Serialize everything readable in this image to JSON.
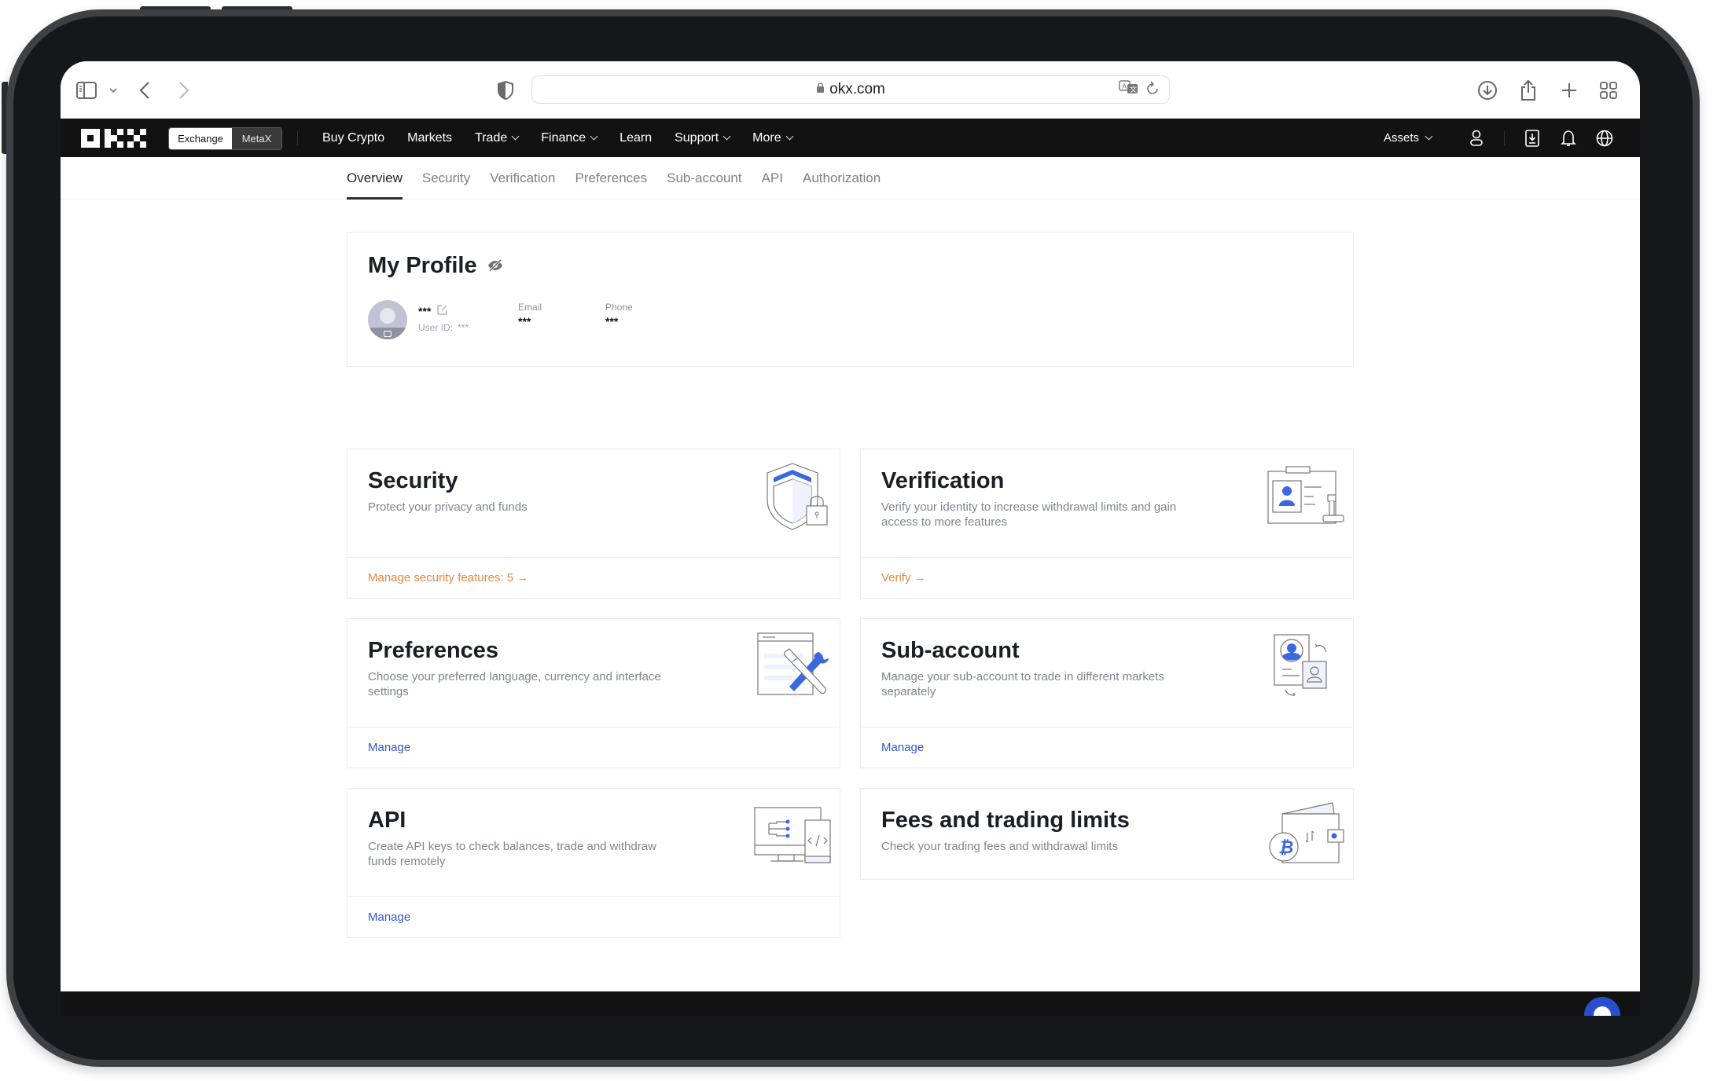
{
  "browser": {
    "url": "okx.com",
    "icons": [
      "sidebar-icon",
      "chevron-down-icon",
      "back-icon",
      "forward-icon",
      "shield-icon",
      "lock-icon",
      "translate-icon",
      "reload-icon",
      "download-icon",
      "share-icon",
      "new-tab-icon",
      "tab-overview-icon"
    ]
  },
  "nav": {
    "brand": "OKX",
    "segment": {
      "active": "Exchange",
      "inactive": "MetaX"
    },
    "links": [
      {
        "label": "Buy Crypto",
        "dropdown": false
      },
      {
        "label": "Markets",
        "dropdown": false
      },
      {
        "label": "Trade",
        "dropdown": true
      },
      {
        "label": "Finance",
        "dropdown": true
      },
      {
        "label": "Learn",
        "dropdown": false
      },
      {
        "label": "Support",
        "dropdown": true
      },
      {
        "label": "More",
        "dropdown": true
      }
    ],
    "assets_label": "Assets",
    "right_icons": [
      "user-icon",
      "download-app-icon",
      "bell-icon",
      "globe-icon"
    ]
  },
  "subnav": {
    "tabs": [
      "Overview",
      "Security",
      "Verification",
      "Preferences",
      "Sub-account",
      "API",
      "Authorization"
    ],
    "active": "Overview"
  },
  "profile": {
    "title": "My Profile",
    "name": "***",
    "user_id_label": "User ID:",
    "user_id": "***",
    "email_label": "Email",
    "email": "***",
    "phone_label": "Phone",
    "phone": "***"
  },
  "cards": {
    "security": {
      "title": "Security",
      "desc": "Protect your privacy and funds",
      "action": "Manage security features: 5 →"
    },
    "verification": {
      "title": "Verification",
      "desc": "Verify your identity to increase withdrawal limits and gain access to more features",
      "action": "Verify →"
    },
    "preferences": {
      "title": "Preferences",
      "desc": "Choose your preferred language, currency and interface settings",
      "action": "Manage"
    },
    "subaccount": {
      "title": "Sub-account",
      "desc": "Manage your sub-account to trade in different markets separately",
      "action": "Manage"
    },
    "api": {
      "title": "API",
      "desc": "Create API keys to check balances, trade and withdraw funds remotely",
      "action": "Manage"
    },
    "fees": {
      "title": "Fees and trading limits",
      "desc": "Check your trading fees and withdrawal limits"
    }
  },
  "colors": {
    "accent_blue": "#3556d4",
    "accent_orange": "#e8873a",
    "nav_bg": "#121212",
    "chat_bubble": "#2a4fce"
  }
}
